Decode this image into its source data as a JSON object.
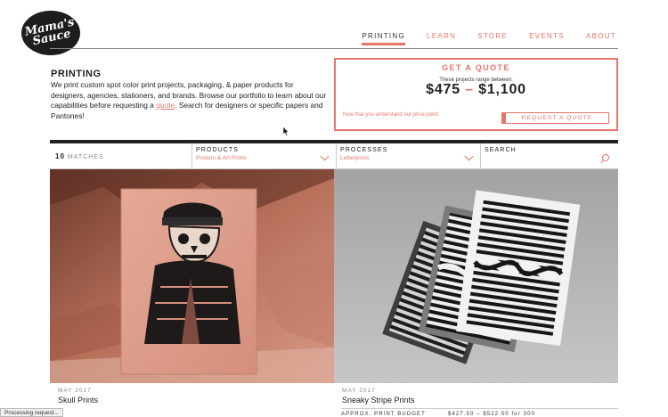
{
  "logo": {
    "text": "Mama's Sauce"
  },
  "nav": {
    "items": [
      {
        "label": "PRINTING",
        "active": true
      },
      {
        "label": "LEARN",
        "active": false
      },
      {
        "label": "STORE",
        "active": false
      },
      {
        "label": "EVENTS",
        "active": false
      },
      {
        "label": "ABOUT",
        "active": false
      }
    ]
  },
  "intro": {
    "title": "PRINTING",
    "text_before": "We print custom spot color print projects, packaging, & paper products for designers, agencies, stationers, and brands. Browse our portfolio to learn about our capabilities before requesting a ",
    "link": "quote",
    "text_after": ". Search for designers or specific papers and Pantones!"
  },
  "quote": {
    "heading": "GET A QUOTE",
    "sub": "These projects range between:",
    "low": "$475",
    "dash": "–",
    "high": "$1,100",
    "prompt": "Now that you understand our price point:",
    "button": "REQUEST A QUOTE"
  },
  "filters": {
    "count": "10",
    "matches_label": "MATCHES",
    "products_label": "PRODUCTS",
    "products_value": "Posters & Art Prints",
    "processes_label": "PROCESSES",
    "processes_value": "Letterpress",
    "search_label": "SEARCH"
  },
  "cards": [
    {
      "date": "MAY 2017",
      "title": "Skull Prints"
    },
    {
      "date": "MAY 2017",
      "title": "Sneaky Stripe Prints",
      "budget_label": "APPROX. PRINT BUDGET",
      "budget_value": "$427.50 – $522.50 for 300"
    }
  ],
  "status": "Processing request...",
  "colors": {
    "accent": "#e8756a",
    "dark": "#222222"
  }
}
